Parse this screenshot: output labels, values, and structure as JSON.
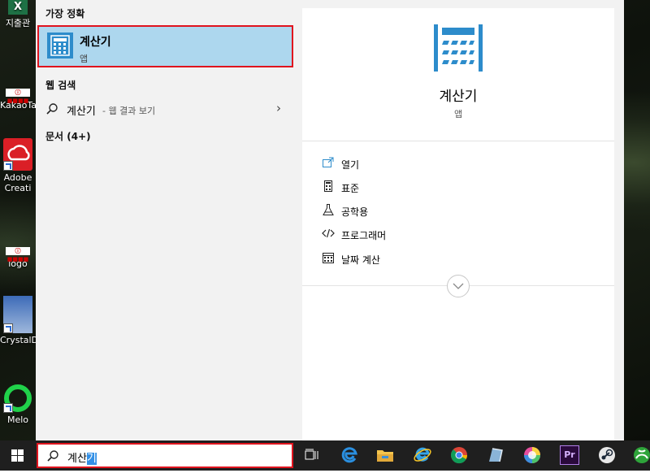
{
  "desktop": {
    "icons": [
      {
        "label": "지출관",
        "badge": "X"
      },
      {
        "label": "KakaoTa",
        "badge": "ⓘ ■■■■"
      },
      {
        "label": "Adobe Creati"
      },
      {
        "label": "logo",
        "badge": "ⓘ ■■■■"
      },
      {
        "label": "CrystalD"
      },
      {
        "label": "Melo"
      }
    ]
  },
  "left": {
    "best_match_header": "가장 정확",
    "best_match": {
      "title": "계산기",
      "subtitle": "앱"
    },
    "web_header": "웹 검색",
    "web_result": {
      "query": "계산기",
      "suffix": "- 웹 결과 보기",
      "chevron": "›"
    },
    "docs_header": "문서 (4+)"
  },
  "detail": {
    "title": "계산기",
    "subtitle": "앱",
    "actions": [
      {
        "label": "열기",
        "icon": "open-icon"
      },
      {
        "label": "표준",
        "icon": "calculator-icon"
      },
      {
        "label": "공학용",
        "icon": "flask-icon"
      },
      {
        "label": "프로그래머",
        "icon": "code-icon"
      },
      {
        "label": "날짜 계산",
        "icon": "calendar-icon"
      }
    ]
  },
  "search": {
    "typed": "계산",
    "selected": "기"
  },
  "taskbar": {
    "apps": [
      "task-view-icon",
      "edge-icon",
      "file-explorer-icon",
      "ie-icon",
      "chrome-icon",
      "app-icon",
      "color-wheel-icon",
      "premiere-icon",
      "steam-icon",
      "xbox-icon"
    ],
    "premiere_label": "Pr"
  },
  "colors": {
    "accent": "#2d8ccb",
    "selection": "#add7ee",
    "highlight_border": "#e0141e"
  }
}
